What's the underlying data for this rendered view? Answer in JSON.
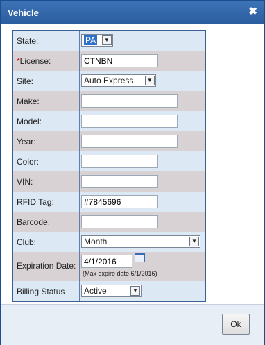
{
  "dialog": {
    "title": "Vehicle",
    "close_glyph": "✖"
  },
  "form": {
    "state": {
      "label": "State:",
      "value": "PA"
    },
    "license": {
      "required_mark": "*",
      "label": "License:",
      "value": "CTNBN"
    },
    "site": {
      "label": "Site:",
      "value": "Auto Express"
    },
    "make": {
      "label": "Make:",
      "value": ""
    },
    "model": {
      "label": "Model:",
      "value": ""
    },
    "year": {
      "label": "Year:",
      "value": ""
    },
    "color": {
      "label": "Color:",
      "value": ""
    },
    "vin": {
      "label": "VIN:",
      "value": ""
    },
    "rfid": {
      "label": "RFID Tag:",
      "value": "#7845696"
    },
    "barcode": {
      "label": "Barcode:",
      "value": ""
    },
    "club": {
      "label": "Club:",
      "value": "Month"
    },
    "expiration": {
      "label": "Expiration Date:",
      "value": "4/1/2016",
      "hint": "(Max expire date 6/1/2016)"
    },
    "billing": {
      "label": "Billing Status",
      "value": "Active"
    }
  },
  "footer": {
    "ok_label": "Ok"
  }
}
